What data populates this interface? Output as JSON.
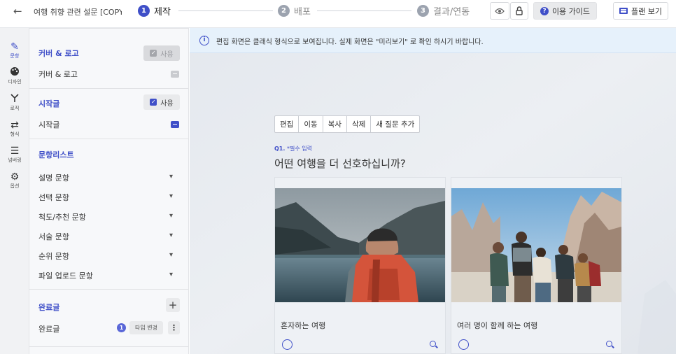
{
  "topbar": {
    "back_label": "←",
    "survey_title": "여행 취향 관련 설문 [COPY]",
    "steps": [
      {
        "num": "1",
        "label": "제작"
      },
      {
        "num": "2",
        "label": "배포"
      },
      {
        "num": "3",
        "label": "결과/연동"
      }
    ],
    "guide_label": "이용 가이드",
    "plan_label": "플랜 보기",
    "accent_color": "#3f4fc8"
  },
  "rail": {
    "items": [
      {
        "icon": "pencil-icon",
        "glyph": "✎",
        "label": "문항"
      },
      {
        "icon": "palette-icon",
        "glyph": "🎨",
        "label": "디자인"
      },
      {
        "icon": "logic-icon",
        "glyph": "⑂",
        "label": "로직"
      },
      {
        "icon": "swap-icon",
        "glyph": "⇄",
        "label": "형식"
      },
      {
        "icon": "numbering-icon",
        "glyph": "☰",
        "label": "넘버링"
      },
      {
        "icon": "gear-icon",
        "glyph": "⚙",
        "label": "옵션"
      }
    ]
  },
  "sidebar": {
    "cover": {
      "header": "커버 & 로고",
      "use_label": "사용",
      "item": "커버 & 로고"
    },
    "intro": {
      "header": "시작글",
      "use_label": "사용",
      "item": "시작글"
    },
    "list": {
      "header": "문항리스트",
      "items": [
        "설명 문항",
        "선택 문항",
        "척도/추천 문항",
        "서술 문항",
        "순위 문항",
        "파일 업로드 문항"
      ]
    },
    "outro": {
      "header": "완료글",
      "item": "완료글",
      "badge": "1",
      "type_change": "타입 변경",
      "more": "⋮",
      "add": "+"
    }
  },
  "notice": {
    "text": "편집 화면은 클래식 형식으로 보여집니다. 실제 화면은 \"미리보기\" 로 확인 하시기 바랍니다."
  },
  "question": {
    "tools": [
      "편집",
      "이동",
      "복사",
      "삭제",
      "새 질문 추가"
    ],
    "number": "Q1.",
    "required": "*필수 입력",
    "title": "어떤 여행을 더 선호하십니까?",
    "options": [
      {
        "label": "혼자하는 여행"
      },
      {
        "label": "여러 명이 함께 하는 여행"
      }
    ]
  }
}
